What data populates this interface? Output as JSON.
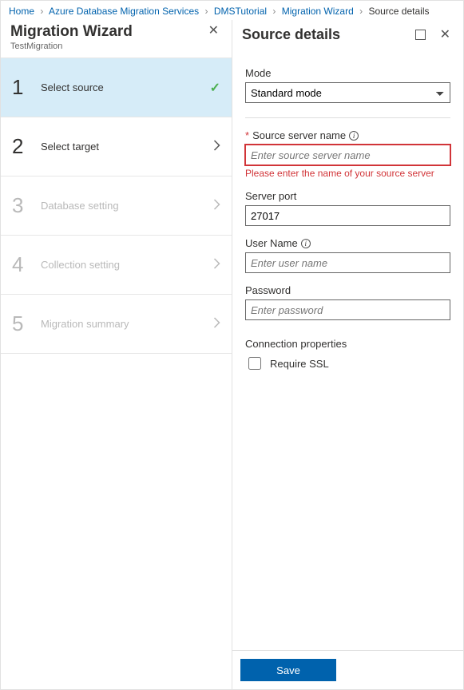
{
  "breadcrumbs": {
    "items": [
      "Home",
      "Azure Database Migration Services",
      "DMSTutorial",
      "Migration Wizard"
    ],
    "current": "Source details"
  },
  "wizard": {
    "title": "Migration Wizard",
    "subtitle": "TestMigration",
    "steps": [
      {
        "num": "1",
        "label": "Select source",
        "active": true,
        "done": true
      },
      {
        "num": "2",
        "label": "Select target",
        "active": false,
        "done": false
      },
      {
        "num": "3",
        "label": "Database setting",
        "active": false,
        "done": false,
        "faded": true
      },
      {
        "num": "4",
        "label": "Collection setting",
        "active": false,
        "done": false,
        "faded": true
      },
      {
        "num": "5",
        "label": "Migration summary",
        "active": false,
        "done": false,
        "faded": true
      }
    ]
  },
  "details": {
    "title": "Source details",
    "mode": {
      "label": "Mode",
      "value": "Standard mode"
    },
    "sourceServer": {
      "label": "Source server name",
      "placeholder": "Enter source server name",
      "value": "",
      "error": "Please enter the name of your source server"
    },
    "serverPort": {
      "label": "Server port",
      "value": "27017"
    },
    "userName": {
      "label": "User Name",
      "placeholder": "Enter user name",
      "value": ""
    },
    "password": {
      "label": "Password",
      "placeholder": "Enter password",
      "value": ""
    },
    "connProps": {
      "label": "Connection properties",
      "ssl_label": "Require SSL",
      "ssl_checked": false
    },
    "save_label": "Save"
  }
}
